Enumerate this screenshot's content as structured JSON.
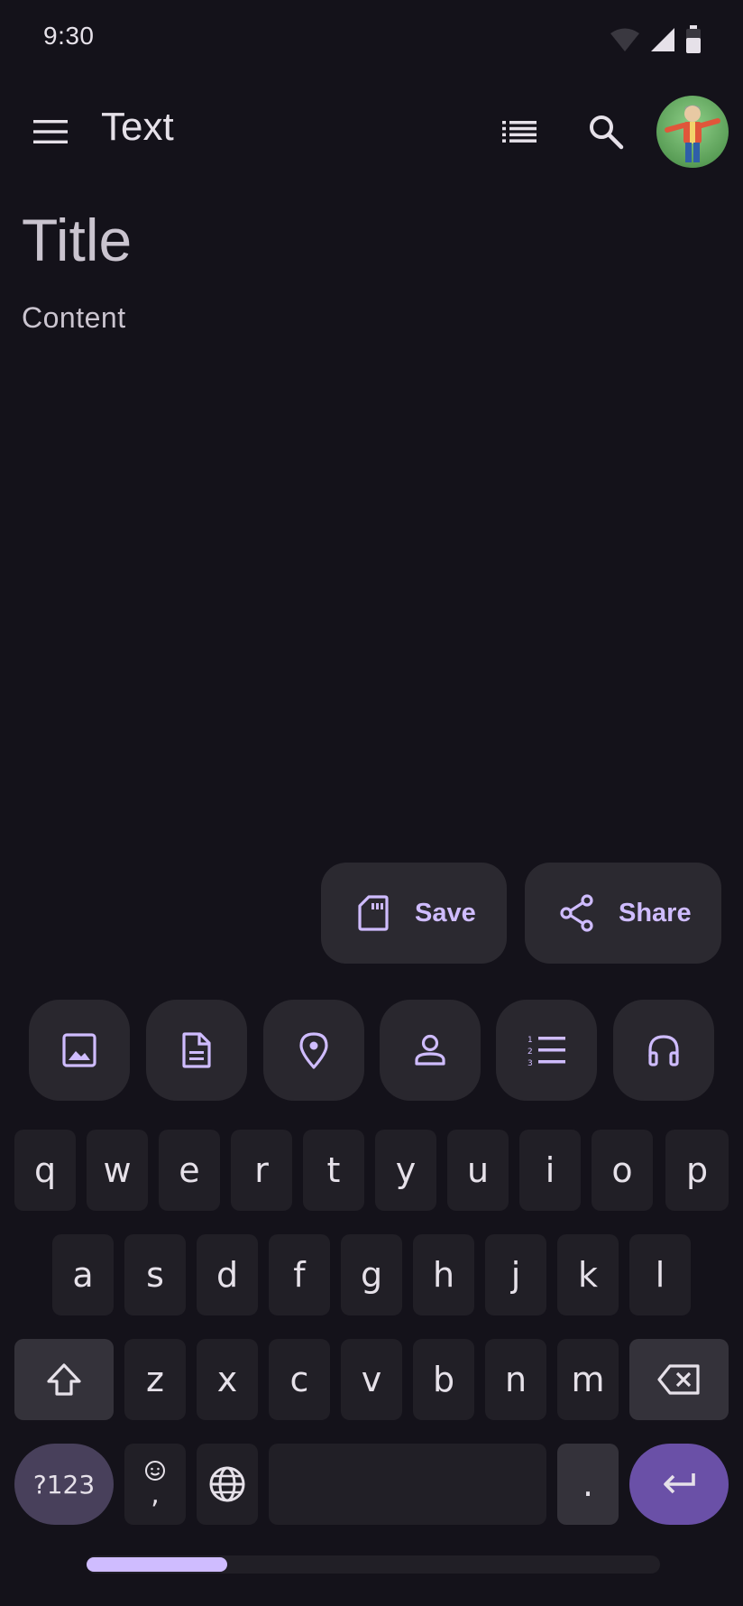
{
  "status_bar": {
    "time": "9:30"
  },
  "app_bar": {
    "title": "Text"
  },
  "note": {
    "title": "Title",
    "content": "Content"
  },
  "actions": {
    "save_label": "Save",
    "share_label": "Share"
  },
  "keyboard": {
    "chips": [
      "image-icon",
      "document-icon",
      "location-icon",
      "person-icon",
      "numbered-list-icon",
      "headphones-icon"
    ],
    "row1": [
      "q",
      "w",
      "e",
      "r",
      "t",
      "y",
      "u",
      "i",
      "o",
      "p"
    ],
    "row2": [
      "a",
      "s",
      "d",
      "f",
      "g",
      "h",
      "j",
      "k",
      "l"
    ],
    "row3": [
      "z",
      "x",
      "c",
      "v",
      "b",
      "n",
      "m"
    ],
    "symbols_label": "?123",
    "comma_label": ",",
    "period_label": "."
  },
  "colors": {
    "background": "#14121a",
    "accent": "#cfbcff",
    "enter_key": "#6a50a7"
  }
}
